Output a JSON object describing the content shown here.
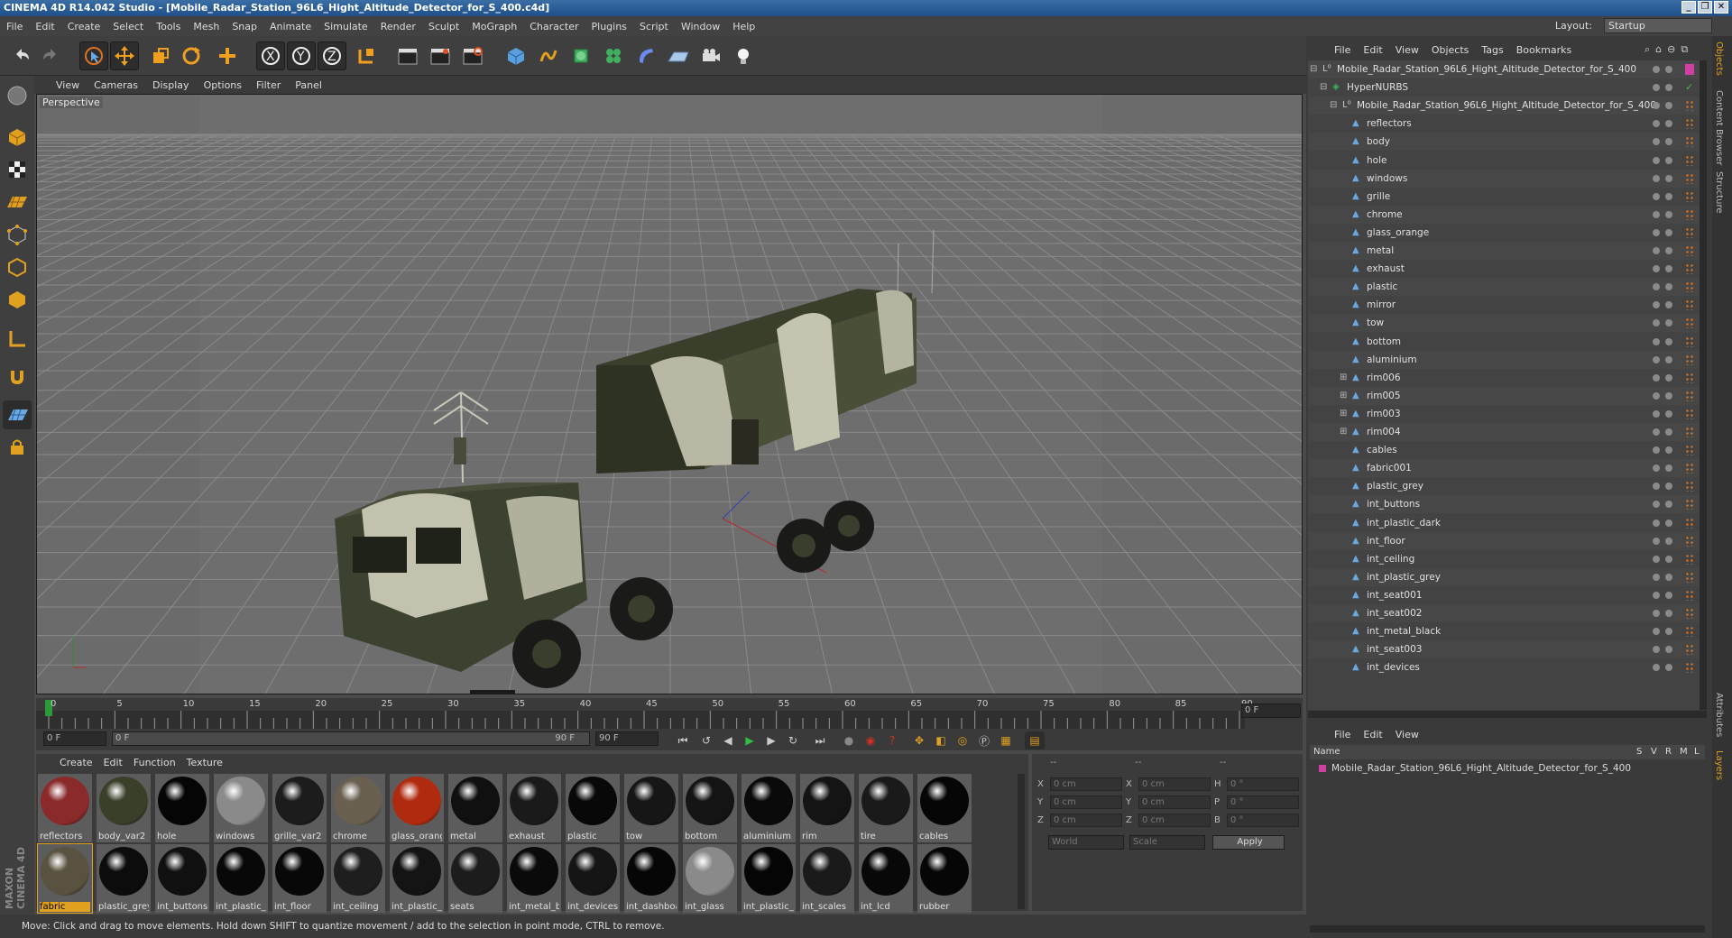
{
  "window": {
    "title": "CINEMA 4D R14.042 Studio - [Mobile_Radar_Station_96L6_Hight_Altitude_Detector_for_S_400.c4d]"
  },
  "menu": [
    "File",
    "Edit",
    "Create",
    "Select",
    "Tools",
    "Mesh",
    "Snap",
    "Animate",
    "Simulate",
    "Render",
    "Sculpt",
    "MoGraph",
    "Character",
    "Plugins",
    "Script",
    "Window",
    "Help"
  ],
  "layout": {
    "label": "Layout:",
    "value": "Startup"
  },
  "viewport": {
    "menu": [
      "View",
      "Cameras",
      "Display",
      "Options",
      "Filter",
      "Panel"
    ],
    "label": "Perspective"
  },
  "timeline": {
    "ticks": [
      "0",
      "5",
      "10",
      "15",
      "20",
      "25",
      "30",
      "35",
      "40",
      "45",
      "50",
      "55",
      "60",
      "65",
      "70",
      "75",
      "80",
      "85",
      "90"
    ],
    "frame_field": "0 F",
    "start": "0 F",
    "slider_start": "0 F",
    "slider_end": "90 F",
    "end": "90 F"
  },
  "materials": {
    "menu": [
      "Create",
      "Edit",
      "Function",
      "Texture"
    ],
    "row1": [
      {
        "name": "reflectors",
        "color": "#8a2a2a"
      },
      {
        "name": "body_var2",
        "color": "#3a3f2a"
      },
      {
        "name": "hole",
        "color": "#050505"
      },
      {
        "name": "windows",
        "color": "#8a8a8a"
      },
      {
        "name": "grille_var2",
        "color": "#1c1c1c"
      },
      {
        "name": "chrome",
        "color": "#6a6050"
      },
      {
        "name": "glass_orang",
        "color": "#b02a10"
      },
      {
        "name": "metal",
        "color": "#101010"
      },
      {
        "name": "exhaust",
        "color": "#1a1a1a"
      },
      {
        "name": "plastic",
        "color": "#080808"
      },
      {
        "name": "tow",
        "color": "#161616"
      },
      {
        "name": "bottom",
        "color": "#141414"
      },
      {
        "name": "aluminium",
        "color": "#0a0a0a"
      },
      {
        "name": "rim",
        "color": "#141414"
      },
      {
        "name": "tire",
        "color": "#1a1a1a"
      },
      {
        "name": "cables",
        "color": "#060606"
      }
    ],
    "row2": [
      {
        "name": "fabric",
        "color": "#5a5240"
      },
      {
        "name": "plastic_grey",
        "color": "#0c0c0c"
      },
      {
        "name": "int_buttons",
        "color": "#101010"
      },
      {
        "name": "int_plastic_d",
        "color": "#080808"
      },
      {
        "name": "int_floor",
        "color": "#080808"
      },
      {
        "name": "int_ceiling",
        "color": "#1e1e1e"
      },
      {
        "name": "int_plastic_c",
        "color": "#141414"
      },
      {
        "name": "seats",
        "color": "#1c1c1c"
      },
      {
        "name": "int_metal_b",
        "color": "#0a0a0a"
      },
      {
        "name": "int_devices",
        "color": "#151515"
      },
      {
        "name": "int_dashboa",
        "color": "#060606"
      },
      {
        "name": "int_glass",
        "color": "#8a8a8a"
      },
      {
        "name": "int_plastic_l",
        "color": "#050505"
      },
      {
        "name": "int_scales",
        "color": "#1a1a1a"
      },
      {
        "name": "int_lcd",
        "color": "#080808"
      },
      {
        "name": "rubber",
        "color": "#060606"
      }
    ]
  },
  "attributes": {
    "headers": [
      "--",
      "--",
      "--"
    ],
    "rows": [
      {
        "a": "X",
        "av": "0 cm",
        "b": "X",
        "bv": "0 cm",
        "c": "H",
        "cv": "0 °"
      },
      {
        "a": "Y",
        "av": "0 cm",
        "b": "Y",
        "bv": "0 cm",
        "c": "P",
        "cv": "0 °"
      },
      {
        "a": "Z",
        "av": "0 cm",
        "b": "Z",
        "bv": "0 cm",
        "c": "B",
        "cv": "0 °"
      }
    ],
    "world": "World",
    "scale": "Scale",
    "apply": "Apply"
  },
  "objects": {
    "menu": [
      "File",
      "Edit",
      "View",
      "Objects",
      "Tags",
      "Bookmarks"
    ],
    "items": [
      {
        "name": "Mobile_Radar_Station_96L6_Hight_Altitude_Detector_for_S_400",
        "level": 0,
        "expand": "−",
        "kind": "null"
      },
      {
        "name": "HyperNURBS",
        "level": 1,
        "expand": "−",
        "kind": "nurbs"
      },
      {
        "name": "Mobile_Radar_Station_96L6_Hight_Altitude_Detector_for_S_400",
        "level": 2,
        "expand": "−",
        "kind": "null"
      },
      {
        "name": "reflectors",
        "level": 3,
        "expand": "",
        "kind": "poly"
      },
      {
        "name": "body",
        "level": 3,
        "expand": "",
        "kind": "poly"
      },
      {
        "name": "hole",
        "level": 3,
        "expand": "",
        "kind": "poly"
      },
      {
        "name": "windows",
        "level": 3,
        "expand": "",
        "kind": "poly"
      },
      {
        "name": "grille",
        "level": 3,
        "expand": "",
        "kind": "poly"
      },
      {
        "name": "chrome",
        "level": 3,
        "expand": "",
        "kind": "poly"
      },
      {
        "name": "glass_orange",
        "level": 3,
        "expand": "",
        "kind": "poly"
      },
      {
        "name": "metal",
        "level": 3,
        "expand": "",
        "kind": "poly"
      },
      {
        "name": "exhaust",
        "level": 3,
        "expand": "",
        "kind": "poly"
      },
      {
        "name": "plastic",
        "level": 3,
        "expand": "",
        "kind": "poly"
      },
      {
        "name": "mirror",
        "level": 3,
        "expand": "",
        "kind": "poly"
      },
      {
        "name": "tow",
        "level": 3,
        "expand": "",
        "kind": "poly"
      },
      {
        "name": "bottom",
        "level": 3,
        "expand": "",
        "kind": "poly"
      },
      {
        "name": "aluminium",
        "level": 3,
        "expand": "",
        "kind": "poly"
      },
      {
        "name": "rim006",
        "level": 3,
        "expand": "+",
        "kind": "poly"
      },
      {
        "name": "rim005",
        "level": 3,
        "expand": "+",
        "kind": "poly"
      },
      {
        "name": "rim003",
        "level": 3,
        "expand": "+",
        "kind": "poly"
      },
      {
        "name": "rim004",
        "level": 3,
        "expand": "+",
        "kind": "poly"
      },
      {
        "name": "cables",
        "level": 3,
        "expand": "",
        "kind": "poly"
      },
      {
        "name": "fabric001",
        "level": 3,
        "expand": "",
        "kind": "poly"
      },
      {
        "name": "plastic_grey",
        "level": 3,
        "expand": "",
        "kind": "poly"
      },
      {
        "name": "int_buttons",
        "level": 3,
        "expand": "",
        "kind": "poly"
      },
      {
        "name": "int_plastic_dark",
        "level": 3,
        "expand": "",
        "kind": "poly"
      },
      {
        "name": "int_floor",
        "level": 3,
        "expand": "",
        "kind": "poly"
      },
      {
        "name": "int_ceiling",
        "level": 3,
        "expand": "",
        "kind": "poly"
      },
      {
        "name": "int_plastic_grey",
        "level": 3,
        "expand": "",
        "kind": "poly"
      },
      {
        "name": "int_seat001",
        "level": 3,
        "expand": "",
        "kind": "poly"
      },
      {
        "name": "int_seat002",
        "level": 3,
        "expand": "",
        "kind": "poly"
      },
      {
        "name": "int_metal_black",
        "level": 3,
        "expand": "",
        "kind": "poly"
      },
      {
        "name": "int_seat003",
        "level": 3,
        "expand": "",
        "kind": "poly"
      },
      {
        "name": "int_devices",
        "level": 3,
        "expand": "",
        "kind": "poly"
      }
    ]
  },
  "layers": {
    "menu": [
      "File",
      "Edit",
      "View"
    ],
    "headers": {
      "name": "Name",
      "s": "S",
      "v": "V",
      "r": "R",
      "m": "M",
      "l": "L"
    },
    "row": "Mobile_Radar_Station_96L6_Hight_Altitude_Detector_for_S_400"
  },
  "side_tabs": [
    "Objects",
    "Content Browser",
    "Structure"
  ],
  "side_tabs2": [
    "Attributes",
    "Layers"
  ],
  "status": "Move: Click and drag to move elements. Hold down SHIFT to quantize movement / add to the selection in point mode, CTRL to remove.",
  "brand": "MAXON CINEMA 4D"
}
